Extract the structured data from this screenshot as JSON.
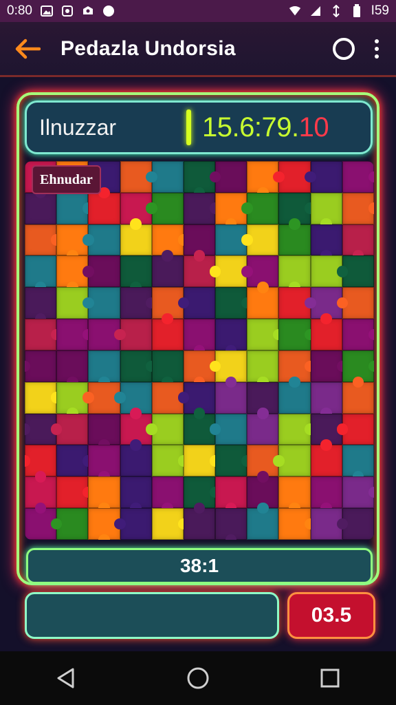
{
  "status_bar": {
    "time": "0:80",
    "battery_text": "I59",
    "icons": [
      "image-icon",
      "message-icon",
      "game-icon",
      "compass-icon",
      "wifi-icon",
      "signal-icon",
      "network-icon",
      "battery-icon"
    ]
  },
  "app_bar": {
    "title": "Pedazla Undorsia",
    "back_icon": "arrow-left-icon",
    "action_icon": "circle-icon",
    "menu_icon": "more-vertical-icon"
  },
  "game": {
    "player_label": "Ilnuzzar",
    "timer_main": "15.6:79.",
    "timer_suffix": "10",
    "puzzle_badge": "Ehnudar",
    "score": "38:1",
    "counter": "03.5"
  },
  "colors": {
    "accent_orange": "#ff8a1c",
    "timer_green": "#c8ff30",
    "timer_red": "#ff3a4a",
    "counter_red": "#c4102e",
    "panel_teal": "#1c4e58"
  },
  "nav_bar": {
    "icons": [
      "back-triangle-icon",
      "home-circle-icon",
      "recents-square-icon"
    ]
  }
}
